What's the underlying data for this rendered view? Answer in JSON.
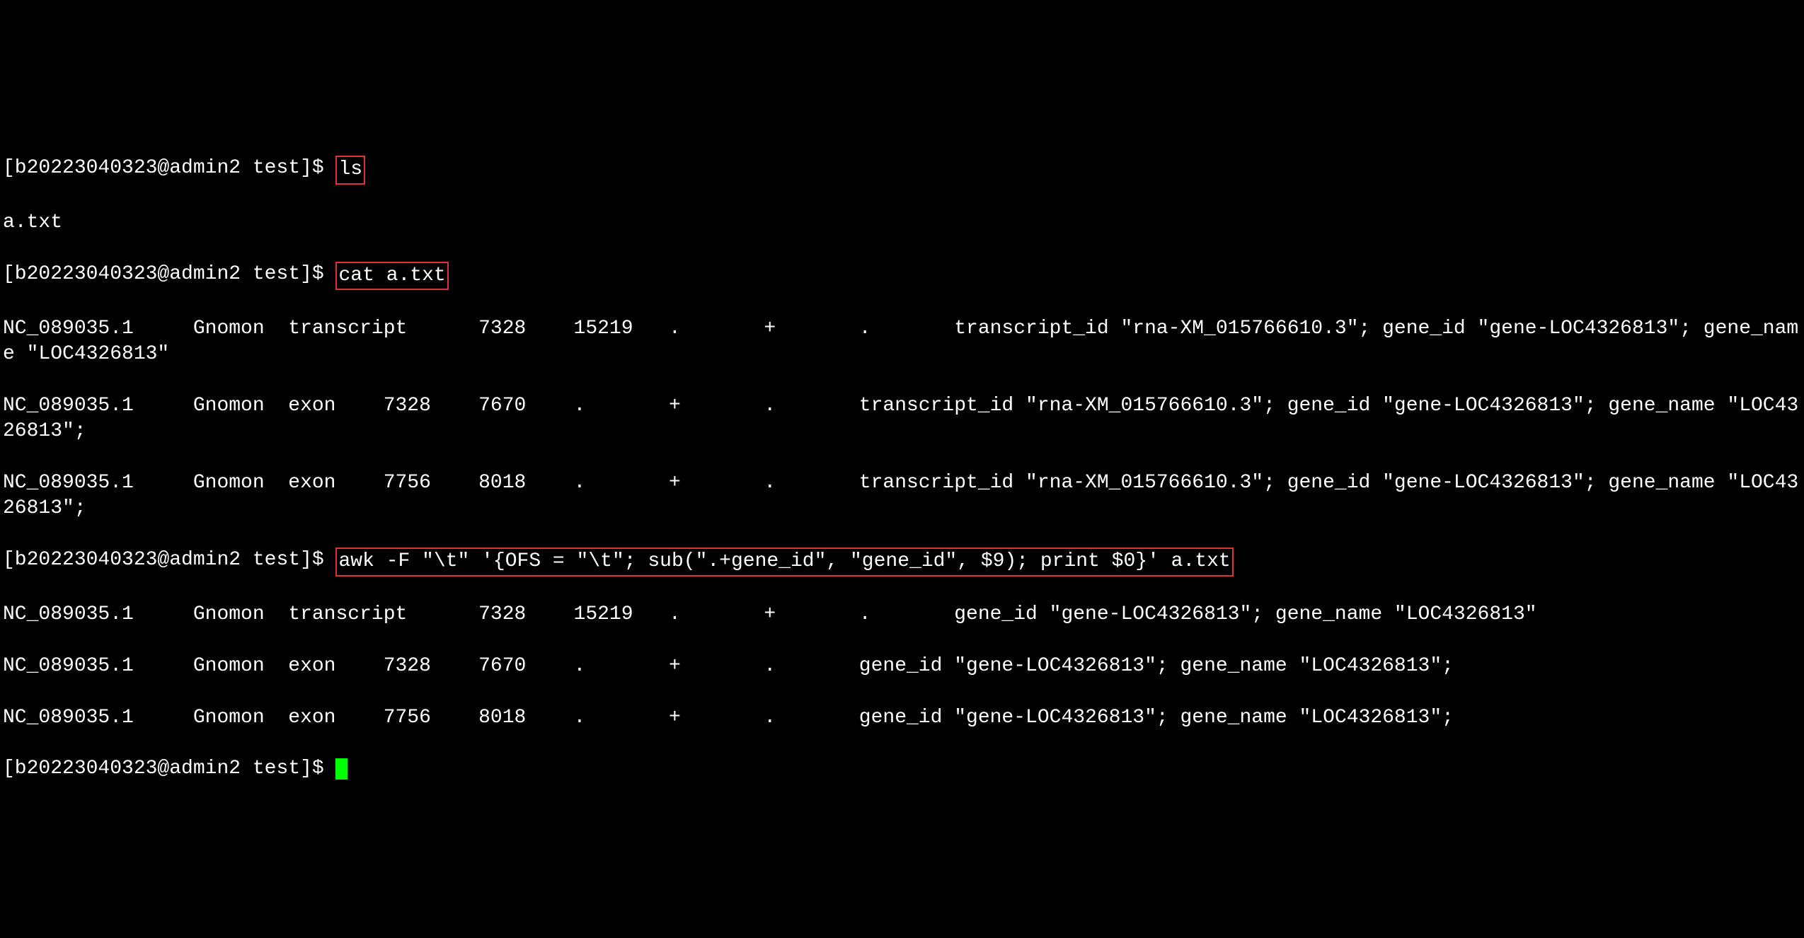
{
  "prompt": "[b20223040323@admin2 test]$ ",
  "cmd1": "ls",
  "out1": "a.txt",
  "cmd2": "cat a.txt",
  "cat_lines": [
    "NC_089035.1     Gnomon  transcript      7328    15219   .       +       .       transcript_id \"rna-XM_015766610.3\"; gene_id \"gene-LOC4326813\"; gene_name \"LOC4326813\"",
    "NC_089035.1     Gnomon  exon    7328    7670    .       +       .       transcript_id \"rna-XM_015766610.3\"; gene_id \"gene-LOC4326813\"; gene_name \"LOC4326813\";",
    "NC_089035.1     Gnomon  exon    7756    8018    .       +       .       transcript_id \"rna-XM_015766610.3\"; gene_id \"gene-LOC4326813\"; gene_name \"LOC4326813\";"
  ],
  "cmd3": "awk -F \"\\t\" '{OFS = \"\\t\"; sub(\".+gene_id\", \"gene_id\", $9); print $0}' a.txt",
  "awk_lines": [
    "NC_089035.1     Gnomon  transcript      7328    15219   .       +       .       gene_id \"gene-LOC4326813\"; gene_name \"LOC4326813\"",
    "NC_089035.1     Gnomon  exon    7328    7670    .       +       .       gene_id \"gene-LOC4326813\"; gene_name \"LOC4326813\";",
    "NC_089035.1     Gnomon  exon    7756    8018    .       +       .       gene_id \"gene-LOC4326813\"; gene_name \"LOC4326813\";"
  ]
}
